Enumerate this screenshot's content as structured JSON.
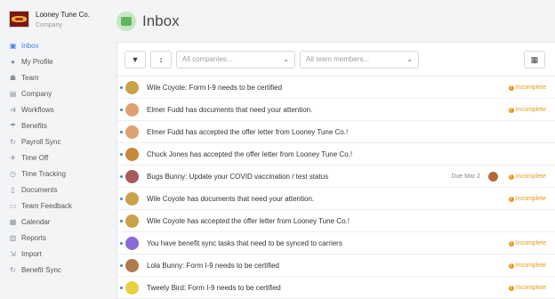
{
  "company": {
    "name": "Looney Tune Co.",
    "subtitle": "Company"
  },
  "sidebar": {
    "items": [
      {
        "label": "Inbox",
        "icon": "inbox-icon",
        "glyph": "▣",
        "active": true
      },
      {
        "label": "My Profile",
        "icon": "user-icon",
        "glyph": "●"
      },
      {
        "label": "Team",
        "icon": "team-icon",
        "glyph": "☗"
      },
      {
        "label": "Company",
        "icon": "building-icon",
        "glyph": "▤"
      },
      {
        "label": "Workflows",
        "icon": "workflows-icon",
        "glyph": "⇉"
      },
      {
        "label": "Benefits",
        "icon": "umbrella-icon",
        "glyph": "☂"
      },
      {
        "label": "Payroll Sync",
        "icon": "sync-icon",
        "glyph": "↻"
      },
      {
        "label": "Time Off",
        "icon": "plane-icon",
        "glyph": "✈"
      },
      {
        "label": "Time Tracking",
        "icon": "clock-icon",
        "glyph": "◷"
      },
      {
        "label": "Documents",
        "icon": "document-icon",
        "glyph": "▯"
      },
      {
        "label": "Team Feedback",
        "icon": "chat-icon",
        "glyph": "▭"
      },
      {
        "label": "Calendar",
        "icon": "calendar-icon",
        "glyph": "▦"
      },
      {
        "label": "Reports",
        "icon": "bar-chart-icon",
        "glyph": "▥"
      },
      {
        "label": "Import",
        "icon": "import-icon",
        "glyph": "⇲"
      },
      {
        "label": "Benefit Sync",
        "icon": "benefit-sync-icon",
        "glyph": "↻"
      }
    ]
  },
  "page": {
    "title": "Inbox"
  },
  "toolbar": {
    "filter_icon": "▼",
    "sort_icon": "↕",
    "companies_placeholder": "All companies...",
    "members_placeholder": "All team members...",
    "calendar_icon": "▦"
  },
  "inbox": {
    "status_label": "Incomplete",
    "rows": [
      {
        "text": "Wile Coyote: Form I-9 needs to be certified",
        "status": "Incomplete",
        "avatar": "#c9a24a"
      },
      {
        "text": "Elmer Fudd has documents that need your attention.",
        "status": "Incomplete",
        "avatar": "#e0a070"
      },
      {
        "text": "Elmer Fudd has accepted the offer letter from Looney Tune Co.!",
        "status": "",
        "avatar": "#e0a070"
      },
      {
        "text": "Chuck Jones has accepted the offer letter from Looney Tune Co.!",
        "status": "",
        "avatar": "#c8883a"
      },
      {
        "text": "Bugs Bunny: Update your COVID vaccination / test status",
        "status": "Incomplete",
        "due": "Due Mar 2",
        "avatar": "#a85a5a"
      },
      {
        "text": "Wile Coyote has documents that need your attention.",
        "status": "Incomplete",
        "avatar": "#c9a24a"
      },
      {
        "text": "Wile Coyote has accepted the offer letter from Looney Tune Co.!",
        "status": "",
        "avatar": "#c9a24a"
      },
      {
        "text": "You have benefit sync tasks that need to be synced to carriers",
        "status": "Incomplete",
        "avatar": "#8a6ad8"
      },
      {
        "text": "Lola Bunny: Form I-9 needs to be certified",
        "status": "Incomplete",
        "avatar": "#b07a4a"
      },
      {
        "text": "Tweety Bird: Form I-9 needs to be certified",
        "status": "Incomplete",
        "avatar": "#e8d040"
      }
    ]
  }
}
